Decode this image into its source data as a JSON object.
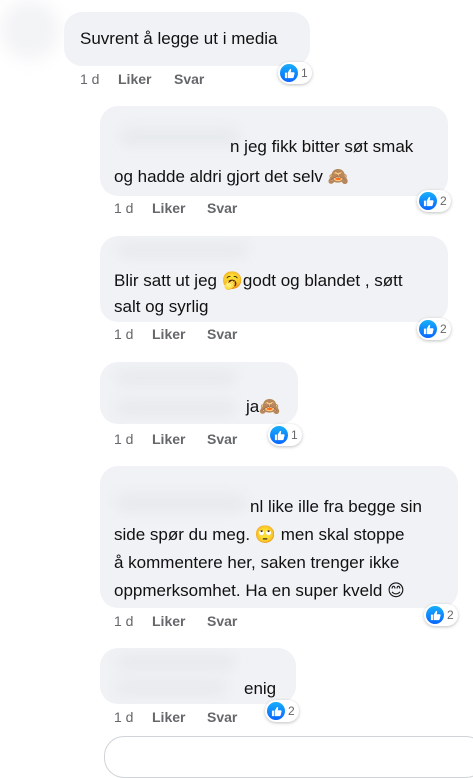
{
  "comments": [
    {
      "text": "Suvrent å legge ut i media",
      "time": "1 d",
      "like": "Liker",
      "reply": "Svar",
      "reactions": "1"
    },
    {
      "line1": "n jeg fikk bitter søt smak",
      "line2": "og hadde aldri gjort det selv",
      "emoji2": "🙈",
      "time": "1 d",
      "like": "Liker",
      "reply": "Svar",
      "reactions": "2"
    },
    {
      "line1a": "Blir satt ut jeg",
      "emoji1": "🥱",
      "line1b": "godt og blandet , søtt",
      "line2": "salt og syrlig",
      "time": "1 d",
      "like": "Liker",
      "reply": "Svar",
      "reactions": "2"
    },
    {
      "text": "ja",
      "emoji": "🙈",
      "time": "1 d",
      "like": "Liker",
      "reply": "Svar",
      "reactions": "1"
    },
    {
      "line1": "nl  like ille fra begge sin",
      "line2a": "side spør du meg.",
      "emoji2": "🙄",
      "line2b": "men skal stoppe",
      "line3": "å kommentere her,  saken trenger ikke",
      "line4": "oppmerksomhet.  Ha en super kveld",
      "emoji4": "😊",
      "time": "1 d",
      "like": "Liker",
      "reply": "Svar",
      "reactions": "2"
    },
    {
      "text": "enig",
      "time": "1 d",
      "like": "Liker",
      "reply": "Svar",
      "reactions": "2"
    }
  ],
  "icons": {
    "reaction": "thumbs-up-icon",
    "reaction_color": "#0866ff"
  }
}
